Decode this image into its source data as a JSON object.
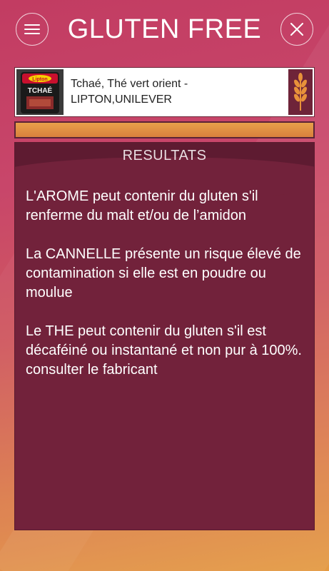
{
  "header": {
    "title": "GLUTEN FREE",
    "menu_icon": "hamburger-menu-icon",
    "close_icon": "close-icon"
  },
  "product": {
    "name_line1": "Tchaé, Thé vert orient -",
    "name_line2": "LIPTON,UNILEVER",
    "thumbnail_brand": "Lipton",
    "thumbnail_label": "TCHAÉ",
    "badge_icon": "wheat-icon"
  },
  "progress": {
    "fill_fraction": 1.0
  },
  "results": {
    "title": "RESULTATS",
    "paragraphs": [
      "L'AROME peut contenir du gluten s'il renferme du malt et/ou de l’amidon",
      "La CANNELLE présente un risque élevé de contamination si elle est en poudre ou moulue",
      "Le THE peut contenir du gluten s'il est décaféiné ou instantané et non pur à 100%. consulter le fabricant"
    ]
  },
  "colors": {
    "panel": "#72223b",
    "panel_header": "#5e1b31",
    "accent_orange": "#e8a04a",
    "badge": "#6e2439"
  }
}
